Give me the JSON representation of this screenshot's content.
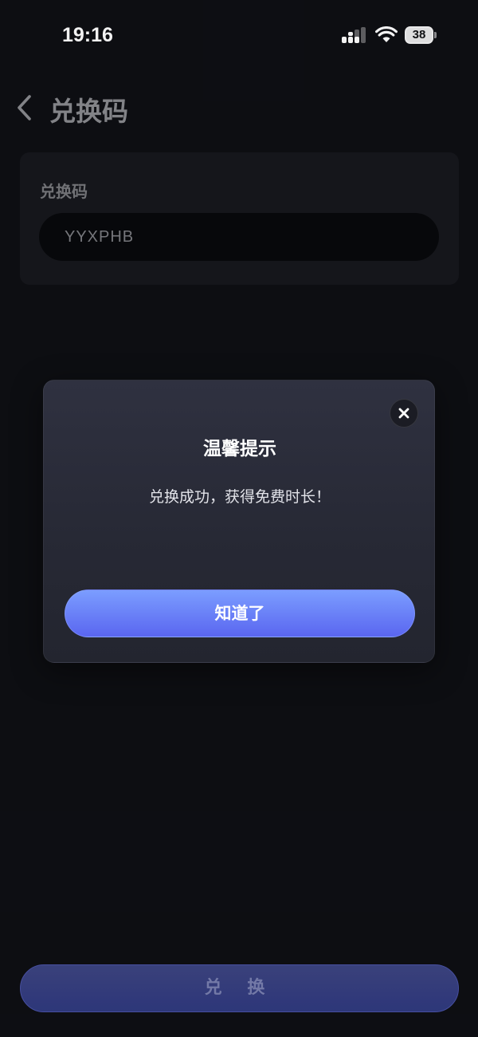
{
  "status_bar": {
    "time": "19:16",
    "battery_level": "38",
    "icons": [
      "signal-icon",
      "wifi-icon",
      "battery-icon"
    ]
  },
  "nav": {
    "title": "兑换码",
    "back_icon": "chevron-left-icon"
  },
  "redeem_form": {
    "label": "兑换码",
    "input_value": "YYXPHB",
    "submit_label": "兑 换"
  },
  "dialog": {
    "title": "温馨提示",
    "message": "兑换成功，获得免费时长！",
    "confirm_label": "知道了",
    "close_icon": "close-icon"
  },
  "colors": {
    "background": "#0e0f14",
    "card": "#17181d",
    "dialog": "#2a2c38",
    "accent_start": "#7b9dff",
    "accent_end": "#5a66f0"
  }
}
